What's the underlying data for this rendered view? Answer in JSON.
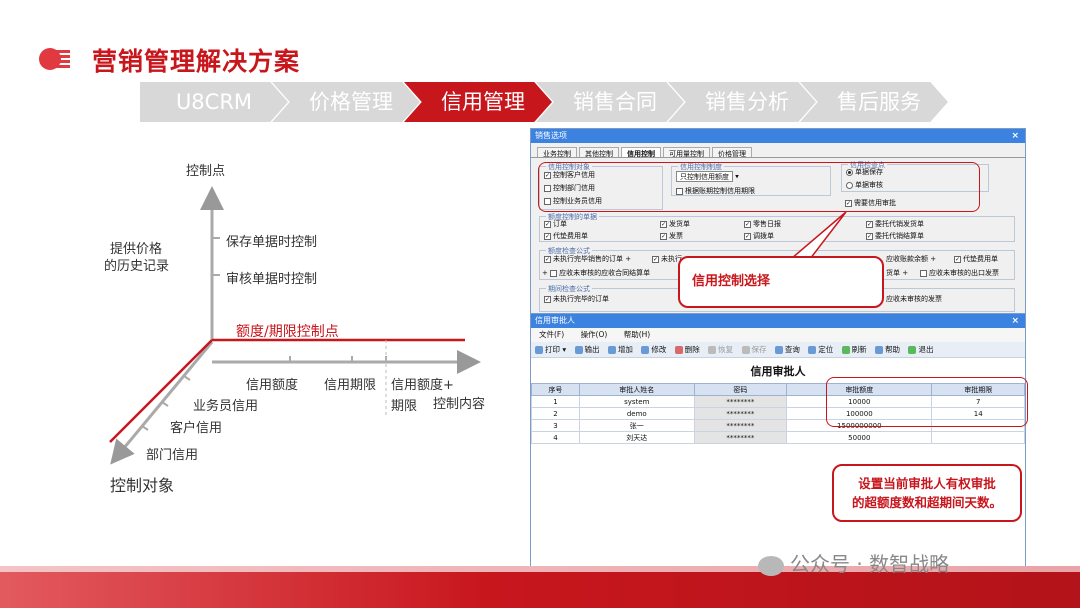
{
  "title": "营销管理解决方案",
  "nav": [
    "U8CRM",
    "价格管理",
    "信用管理",
    "销售合同",
    "销售分析",
    "售后服务"
  ],
  "nav_active_index": 2,
  "diagram": {
    "y_axis": "控制点",
    "history": [
      "提供价格",
      "的历史记录"
    ],
    "save_point": "保存单据时控制",
    "audit_point": "审核单据时控制",
    "limit_point": "额度/期限控制点",
    "x_items": [
      "信用额度",
      "信用期限",
      "信用额度+",
      "期限"
    ],
    "x_axis": "控制内容",
    "z_items": [
      "业务员信用",
      "客户信用",
      "部门信用"
    ],
    "z_axis": "控制对象"
  },
  "sales_options": {
    "title": "销售选项",
    "close": "×",
    "tabs": [
      "业务控制",
      "其他控制",
      "信用控制",
      "可用量控制",
      "价格管理"
    ],
    "selected_tab": 2,
    "credit_object": {
      "title": "信用控制对象",
      "items": [
        "控制客户信用",
        "控制部门信用",
        "控制业务员信用"
      ]
    },
    "credit_method": {
      "title": "信用控制制度",
      "combo": "只控制信用额度",
      "check": "根据账期控制信用期限"
    },
    "credit_checker": {
      "title": "信用检查点",
      "items": [
        "单据保存",
        "单据审核"
      ],
      "need_approval": "需要信用审批"
    },
    "limit_docs": {
      "title": "额度控制的单据",
      "items": [
        "订单",
        "发货单",
        "零售日报",
        "委托代销发货单",
        "代垫费用单",
        "发票",
        "调拨单",
        "委托代销结算单"
      ]
    },
    "formula": {
      "title": "额度检查公式",
      "row1": [
        "未执行完毕销售的订单",
        "未执行",
        "应收账款余额",
        "代垫费用单"
      ],
      "row2": [
        "应收未审核的应收合同结算单",
        "货单",
        "应收未审核的出口发票"
      ]
    },
    "period": {
      "title": "期间检查公式",
      "row1": [
        "未执行完毕的订单",
        "应收未审核的发票"
      ]
    }
  },
  "approver": {
    "title": "信用审批人",
    "close": "×",
    "menu": [
      "文件(F)",
      "操作(O)",
      "帮助(H)"
    ],
    "toolbar": [
      "打印",
      "输出",
      "增加",
      "修改",
      "删除",
      "恢复",
      "保存",
      "查询",
      "定位",
      "刷新",
      "帮助",
      "退出"
    ],
    "toolbar_disabled": [
      "恢复",
      "保存"
    ],
    "grid_title": "信用审批人",
    "columns": [
      "序号",
      "审批人姓名",
      "密码",
      "审批额度",
      "审批期限"
    ],
    "rows": [
      [
        "1",
        "system",
        "********",
        "10000",
        "7"
      ],
      [
        "2",
        "demo",
        "********",
        "100000",
        "14"
      ],
      [
        "3",
        "张一",
        "********",
        "1500000000",
        ""
      ],
      [
        "4",
        "刘天达",
        "********",
        "50000",
        ""
      ]
    ]
  },
  "callout_credit": "信用控制选择",
  "callout_approver": [
    "设置当前审批人有权审批",
    "的超额度数和超期间天数。"
  ],
  "watermark": "公众号 · 数智战略"
}
